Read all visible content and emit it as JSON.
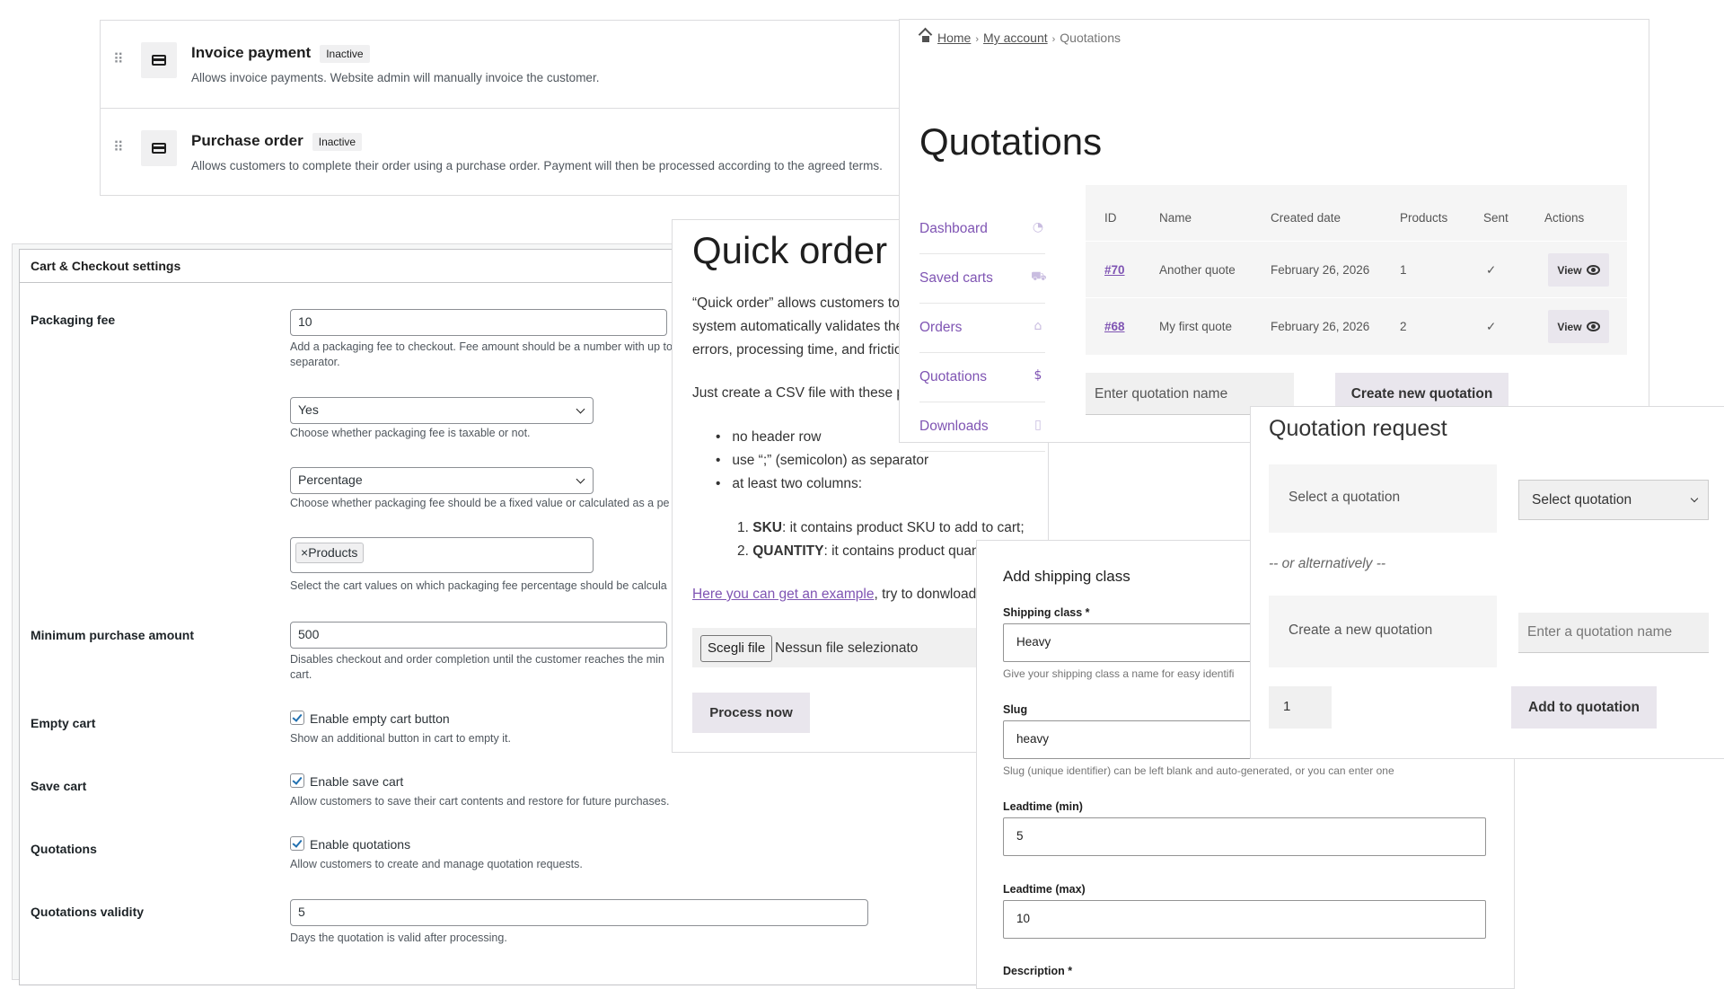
{
  "payments": {
    "items": [
      {
        "title": "Invoice payment",
        "status": "Inactive",
        "description": "Allows invoice payments. Website admin will manually invoice the customer."
      },
      {
        "title": "Purchase order",
        "status": "Inactive",
        "description": "Allows customers to complete their order using a purchase order. Payment will then be processed according to the agreed terms."
      }
    ]
  },
  "cart_settings": {
    "title": "Cart & Checkout settings",
    "packaging_fee": {
      "label": "Packaging fee",
      "value": "10",
      "help": "Add a packaging fee to checkout. Fee amount should be a number with up to",
      "help2": "separator."
    },
    "taxable": {
      "value": "Yes",
      "help": "Choose whether packaging fee is taxable or not."
    },
    "fee_type": {
      "value": "Percentage",
      "help": "Choose whether packaging fee should be a fixed value or calculated as a pe"
    },
    "cart_values": {
      "chip_remove": "×",
      "chip": "Products",
      "help": "Select the cart values on which packaging fee percentage should be calcula"
    },
    "minimum": {
      "label": "Minimum purchase amount",
      "value": "500",
      "help": "Disables checkout and order completion until the customer reaches the min",
      "help2": "cart."
    },
    "empty_cart": {
      "label": "Empty cart",
      "checkbox": "Enable empty cart button",
      "checked": true,
      "help": "Show an additional button in cart to empty it."
    },
    "save_cart": {
      "label": "Save cart",
      "checkbox": "Enable save cart",
      "checked": true,
      "help": "Allow customers to save their cart contents and restore for future purchases."
    },
    "quotations": {
      "label": "Quotations",
      "checkbox": "Enable quotations",
      "checked": true,
      "help": "Allow customers to create and manage quotation requests."
    },
    "validity": {
      "label": "Quotations validity",
      "value": "5",
      "help": "Days the quotation is valid after processing."
    }
  },
  "quick_order": {
    "title": "Quick order",
    "p1_line1": "“Quick order” allows customers to",
    "p1_line2": "system automatically validates the",
    "p1_line3": "errors, processing time, and frictio",
    "p2": "Just create a CSV file with these pro",
    "bullets": [
      "no header row",
      "use “;” (semicolon) as separator",
      "at least two columns:"
    ],
    "cols": [
      {
        "num": "1.",
        "key": "SKU",
        "text": ": it contains product SKU to add to cart;"
      },
      {
        "num": "2.",
        "key": "QUANTITY",
        "text": ": it contains product quanti"
      }
    ],
    "example_link": "Here you can get an example",
    "example_rest": ", try to donwload it",
    "file_button": "Scegli file",
    "file_none": "Nessun file selezionato",
    "process_button": "Process now"
  },
  "account": {
    "breadcrumb": {
      "home": "Home",
      "my_account": "My account",
      "current": "Quotations",
      "separator": "›"
    },
    "title": "Quotations",
    "nav": [
      {
        "label": "Dashboard",
        "icon": "dashboard-icon",
        "glyph": "◔"
      },
      {
        "label": "Saved carts",
        "icon": "cart-icon",
        "glyph": "⛟"
      },
      {
        "label": "Orders",
        "icon": "basket-icon",
        "glyph": "⌂"
      },
      {
        "label": "Quotations",
        "icon": "quote-file-icon",
        "glyph": "$"
      },
      {
        "label": "Downloads",
        "icon": "file-icon",
        "glyph": "▯"
      }
    ],
    "table": {
      "headers": [
        "ID",
        "Name",
        "Created date",
        "Products",
        "Sent",
        "Actions"
      ],
      "rows": [
        {
          "id": "#70",
          "name": "Another quote",
          "date": "February 26, 2026",
          "products": "1",
          "sent": "✓",
          "action": "View"
        },
        {
          "id": "#68",
          "name": "My first quote",
          "date": "February 26, 2026",
          "products": "2",
          "sent": "✓",
          "action": "View"
        }
      ]
    },
    "name_placeholder": "Enter quotation name",
    "create_button": "Create new quotation"
  },
  "shipping": {
    "title": "Add shipping class",
    "class_label": "Shipping class *",
    "class_value": "Heavy",
    "class_help": "Give your shipping class a name for easy identifi",
    "slug_label": "Slug",
    "slug_value": "heavy",
    "slug_help": "Slug (unique identifier) can be left blank and auto-generated, or you can enter one",
    "lead_min_label": "Leadtime (min)",
    "lead_min_value": "5",
    "lead_max_label": "Leadtime (max)",
    "lead_max_value": "10",
    "desc_label": "Description *"
  },
  "quotation_request": {
    "title": "Quotation request",
    "select_label": "Select a quotation",
    "select_value": "Select quotation",
    "alternatively": "-- or alternatively --",
    "create_label": "Create a new quotation",
    "name_placeholder": "Enter a quotation name",
    "quantity": "1",
    "add_button": "Add to quotation"
  }
}
